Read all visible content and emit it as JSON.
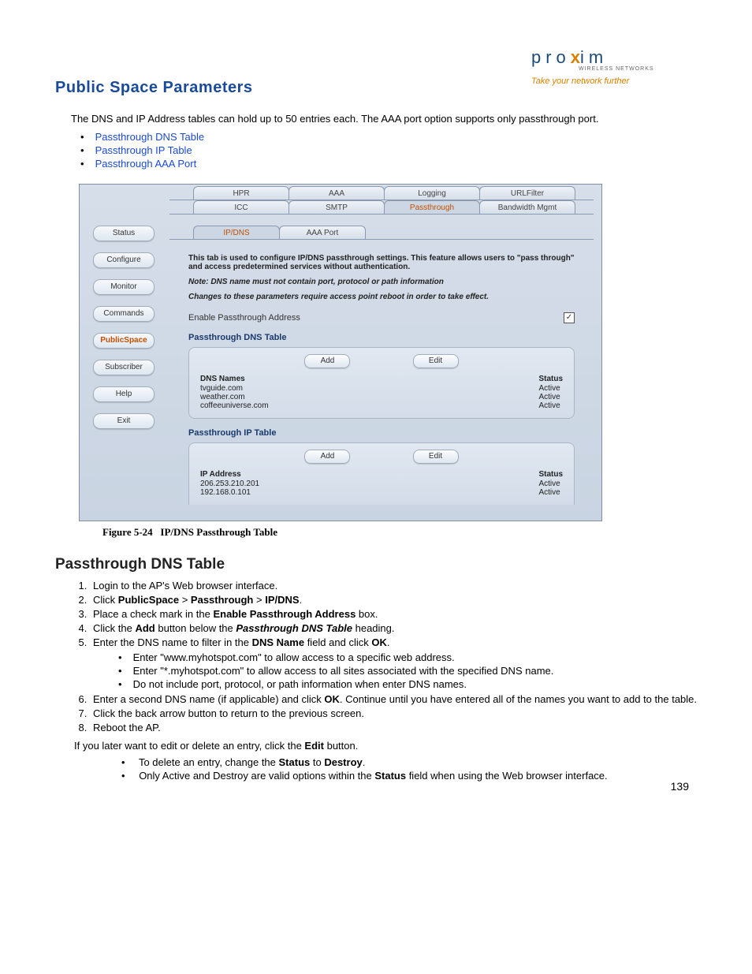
{
  "logo": {
    "name_before_x": "pro",
    "x": "x",
    "name_after_x": "im",
    "sub1": "WIRELESS NETWORKS",
    "sub2": "Take your network further"
  },
  "page_title": "Public Space Parameters",
  "intro": "The DNS and IP Address tables can hold up to 50 entries each. The AAA port option supports only passthrough port.",
  "links": [
    "Passthrough DNS Table",
    "Passthrough IP Table",
    "Passthrough AAA Port"
  ],
  "shot": {
    "sidebar": [
      "Status",
      "Configure",
      "Monitor",
      "Commands",
      "PublicSpace",
      "Subscriber",
      "Help",
      "Exit"
    ],
    "sidebar_active_index": 4,
    "top_tabs_row1": [
      "HPR",
      "AAA",
      "Logging",
      "URLFilter"
    ],
    "top_tabs_row2": [
      "ICC",
      "SMTP",
      "Passthrough",
      "Bandwidth Mgmt"
    ],
    "top_tabs_row2_active_index": 2,
    "sub_tabs": [
      "IP/DNS",
      "AAA Port"
    ],
    "sub_tabs_active_index": 0,
    "desc_main": "This tab is used to configure IP/DNS passthrough settings. This feature allows users to \"pass through\" and access predetermined services without authentication.",
    "desc_note": "Note: DNS name must not contain port, protocol or path information",
    "desc_reboot": "Changes to these parameters require access point reboot in order to take effect.",
    "enable_label": "Enable Passthrough Address",
    "enable_checked": "✓",
    "dns_title": "Passthrough DNS Table",
    "btn_add": "Add",
    "btn_edit": "Edit",
    "dns_header_left": "DNS Names",
    "dns_header_right": "Status",
    "dns_rows": [
      {
        "name": "tvguide.com",
        "status": "Active"
      },
      {
        "name": "weather.com",
        "status": "Active"
      },
      {
        "name": "coffeeuniverse.com",
        "status": "Active"
      }
    ],
    "ip_title": "Passthrough IP Table",
    "ip_header_left": "IP Address",
    "ip_header_right": "Status",
    "ip_rows": [
      {
        "addr": "206.253.210.201",
        "status": "Active"
      },
      {
        "addr": "192.168.0.101",
        "status": "Active"
      }
    ]
  },
  "fig_caption_label": "Figure 5-24",
  "fig_caption_text": "IP/DNS Passthrough Table",
  "section_heading": "Passthrough DNS Table",
  "steps": {
    "s1": "Login to the AP's Web browser interface.",
    "s2_pre": "Click ",
    "s2_b1": "PublicSpace",
    "s2_gt1": " > ",
    "s2_b2": "Passthrough",
    "s2_gt2": " > ",
    "s2_b3": "IP/DNS",
    "s2_post": ".",
    "s3_pre": "Place a check mark in the ",
    "s3_b": "Enable Passthrough Address",
    "s3_post": " box.",
    "s4_pre": "Click the ",
    "s4_b1": "Add",
    "s4_mid": " button below the ",
    "s4_b2": "Passthrough DNS Table",
    "s4_post": " heading.",
    "s5_pre": "Enter the DNS name to filter in the ",
    "s5_b1": "DNS Name",
    "s5_mid": " field and click ",
    "s5_b2": "OK",
    "s5_post": ".",
    "s5_sub": [
      "Enter \"www.myhotspot.com\" to allow access to a specific web address.",
      "Enter \"*.myhotspot.com\" to allow access to all sites associated with the specified DNS name.",
      "Do not include port, protocol, or path information when enter DNS names."
    ],
    "s6_pre": "Enter a second DNS name (if applicable) and click ",
    "s6_b": "OK",
    "s6_post": ". Continue until you have entered all of the names you want to add to the table.",
    "s7": "Click the back arrow button to return to the previous screen.",
    "s8": "Reboot the AP."
  },
  "after_pre": "If you later want to edit or delete an entry, click the ",
  "after_b": "Edit",
  "after_post": " button.",
  "after_sub1_pre": "To delete an entry, change the ",
  "after_sub1_b1": "Status",
  "after_sub1_mid": " to ",
  "after_sub1_b2": "Destroy",
  "after_sub1_post": ".",
  "after_sub2_pre": "Only Active and Destroy are valid options within the ",
  "after_sub2_b": "Status",
  "after_sub2_post": " field when using the Web browser interface.",
  "page_number": "139"
}
